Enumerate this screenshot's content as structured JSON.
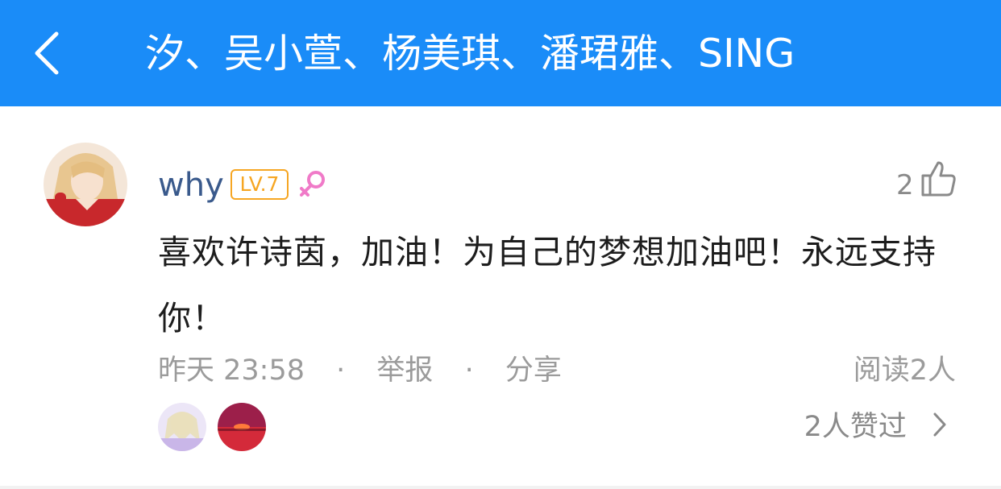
{
  "header": {
    "title": "汐、吴小萱、杨美琪、潘珺雅、SING",
    "back_icon": "chevron-left-icon",
    "background_color": "#1a8cf8"
  },
  "comment": {
    "username": "why",
    "level": "LV.7",
    "gender_icon": "female-icon",
    "like_count": "2",
    "like_icon": "thumbs-up-icon",
    "text": "喜欢许诗茵，加油！为自己的梦想加油吧！永远支持你！",
    "time": "昨天 23:58",
    "separator": "·",
    "report_label": "举报",
    "share_label": "分享",
    "read_count": "阅读2人",
    "liked_summary": "2人赞过",
    "liked_chevron_icon": "chevron-right-icon"
  },
  "colors": {
    "username": "#3a5a8c",
    "level_badge": "#f6a623",
    "gender_icon": "#f07ac8",
    "meta_text": "#9b9b9b"
  }
}
